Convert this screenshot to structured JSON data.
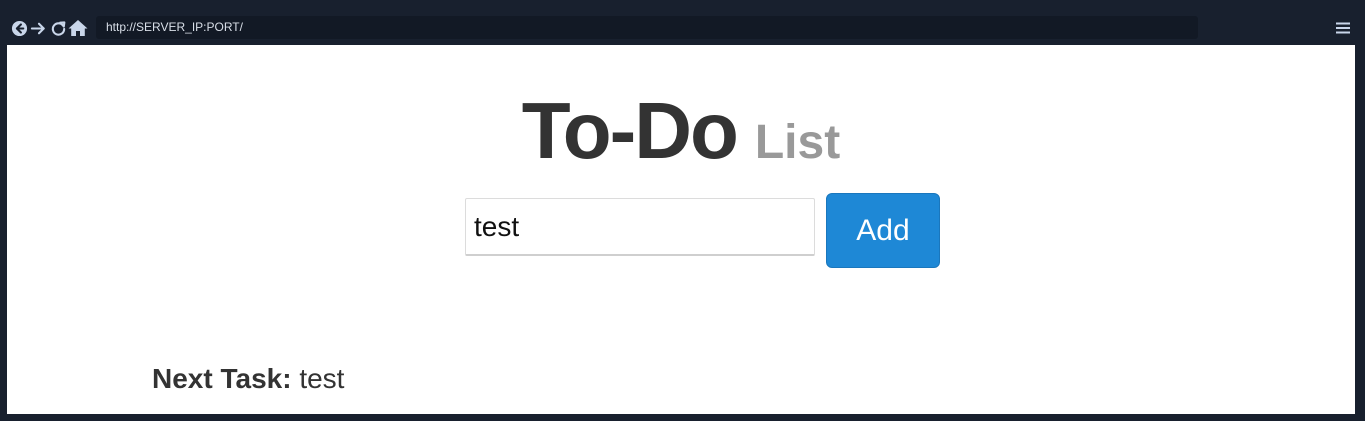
{
  "browser": {
    "url": "http://SERVER_IP:PORT/",
    "icons": {
      "back": "back-circle-arrow-icon",
      "forward": "forward-arrow-icon",
      "reload": "reload-icon",
      "home": "home-icon",
      "menu": "hamburger-menu-icon"
    },
    "colors": {
      "chrome": "#18202e",
      "url_bar": "#121925",
      "icon": "#c9d6ea"
    }
  },
  "page": {
    "title_main": "To-Do",
    "title_sub": "List",
    "task_input": {
      "value": "test",
      "placeholder": ""
    },
    "add_button_label": "Add",
    "next_task": {
      "label": "Next Task:",
      "value": "test"
    },
    "colors": {
      "title": "#333333",
      "subtitle": "#999999",
      "button": "#1e88d6"
    }
  }
}
